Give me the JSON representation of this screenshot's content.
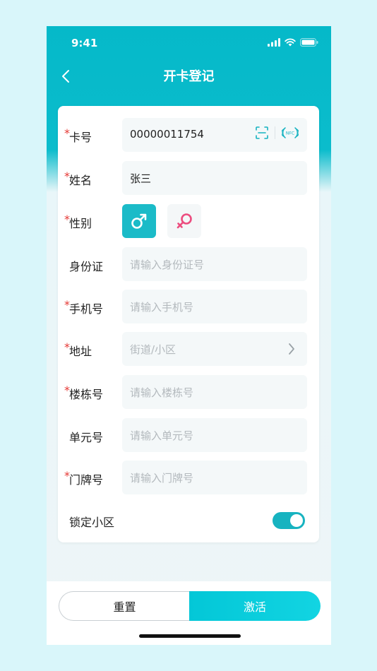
{
  "status_bar": {
    "time": "9:41"
  },
  "nav": {
    "title": "开卡登记"
  },
  "form": {
    "required_mark": "*",
    "card_no": {
      "label": "卡号",
      "value": "00000011754"
    },
    "name": {
      "label": "姓名",
      "value": "张三"
    },
    "gender": {
      "label": "性别",
      "selected": "male"
    },
    "id_card": {
      "label": "身份证",
      "placeholder": "请输入身份证号"
    },
    "phone": {
      "label": "手机号",
      "placeholder": "请输入手机号"
    },
    "address": {
      "label": "地址",
      "placeholder": "街道/小区"
    },
    "building": {
      "label": "楼栋号",
      "placeholder": "请输入楼栋号"
    },
    "unit": {
      "label": "单元号",
      "placeholder": "请输入单元号"
    },
    "door": {
      "label": "门牌号",
      "placeholder": "请输入门牌号"
    },
    "lock_community": {
      "label": "锁定小区",
      "on": true
    }
  },
  "actions": {
    "reset_label": "重置",
    "activate_label": "激活"
  },
  "colors": {
    "primary": "#05b9c9",
    "female_icon": "#ec4d7f",
    "required": "#e53935",
    "page_bg": "#d9f6fa"
  },
  "icons": {
    "scan": "scan-icon",
    "nfc": "nfc-icon",
    "male": "male-icon",
    "female": "female-icon",
    "chevron": "chevron-right-icon",
    "back": "back-icon",
    "nfc_text": "NFC"
  }
}
